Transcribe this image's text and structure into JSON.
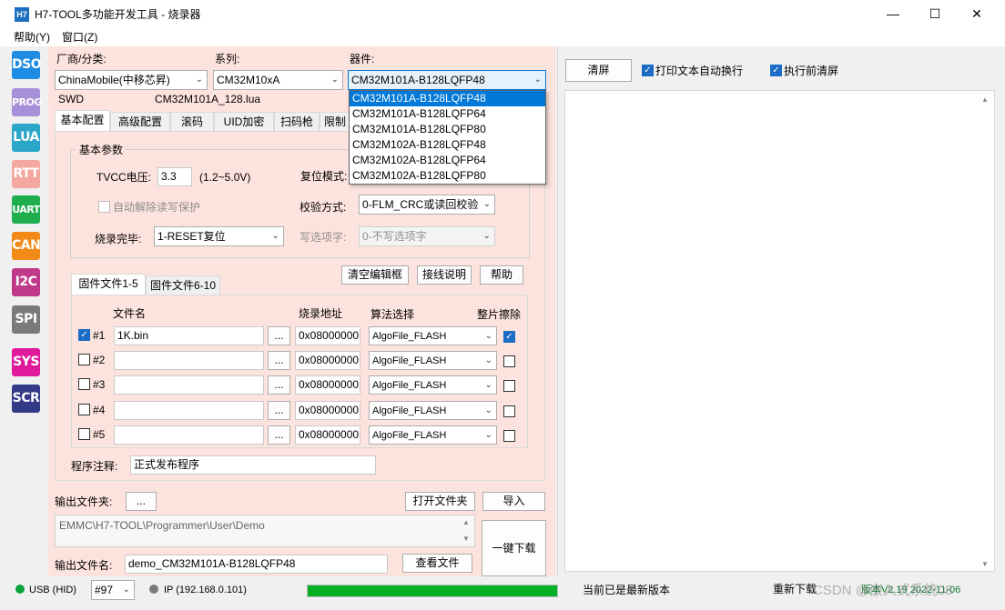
{
  "window": {
    "icon_text": "H7",
    "title": "H7-TOOL多功能开发工具 - 烧录器",
    "minimize": "—",
    "maximize": "☐",
    "close": "✕"
  },
  "menu": [
    "帮助(Y)",
    "窗口(Z)"
  ],
  "toolbar": [
    {
      "label": "DSO",
      "color": "#1f8ce3"
    },
    {
      "label": "PROG",
      "color": "#a890d8"
    },
    {
      "label": "LUA",
      "color": "#2aa6c8"
    },
    {
      "label": "RTT",
      "color": "#f4a8a0"
    },
    {
      "label": "UART",
      "color": "#1fae4e"
    },
    {
      "label": "CAN",
      "color": "#f28a18"
    },
    {
      "label": "I2C",
      "color": "#c0388a"
    },
    {
      "label": "SPI",
      "color": "#7a7a7a"
    },
    {
      "label": "SYS",
      "color": "#e0199a"
    },
    {
      "label": "SCR",
      "color": "#333a88"
    }
  ],
  "selectors": {
    "vendor_label": "厂商/分类:",
    "vendor_value": "ChinaMobile(中移芯昇)",
    "series_label": "系列:",
    "series_value": "CM32M10xA",
    "device_label": "器件:",
    "device_value": "CM32M101A-B128LQFP48",
    "interface": "SWD",
    "lua_file": "CM32M101A_128.lua",
    "device_options": [
      "CM32M101A-B128LQFP48",
      "CM32M101A-B128LQFP64",
      "CM32M101A-B128LQFP80",
      "CM32M102A-B128LQFP48",
      "CM32M102A-B128LQFP64",
      "CM32M102A-B128LQFP80"
    ]
  },
  "tabs": [
    "基本配置",
    "高级配置",
    "滚码",
    "UID加密",
    "扫码枪",
    "限制"
  ],
  "basic": {
    "group_title": "基本参数",
    "tvcc_label": "TVCC电压:",
    "tvcc_value": "3.3",
    "tvcc_range": "(1.2~5.0V)",
    "reset_label": "复位模式:",
    "auto_unlock": "自动解除读写保护",
    "verify_label": "校验方式:",
    "verify_value": "0-FLM_CRC或读回校验",
    "done_label": "烧录完毕:",
    "done_value": "1-RESET复位",
    "option_label": "写选项字:",
    "option_value": "0-不写选项字"
  },
  "file_buttons": {
    "clear": "清空编辑框",
    "wiring": "接线说明",
    "help": "帮助"
  },
  "file_tabs": [
    "固件文件1-5",
    "固件文件6-10"
  ],
  "file_table": {
    "headers": [
      "文件名",
      "烧录地址",
      "算法选择",
      "整片擦除"
    ],
    "browse": "...",
    "rows": [
      {
        "id": "#1",
        "checked": true,
        "file": "1K.bin",
        "addr": "0x08000000",
        "algo": "AlgoFile_FLASH",
        "erase": true
      },
      {
        "id": "#2",
        "checked": false,
        "file": "",
        "addr": "0x08000000",
        "algo": "AlgoFile_FLASH",
        "erase": false
      },
      {
        "id": "#3",
        "checked": false,
        "file": "",
        "addr": "0x08000000",
        "algo": "AlgoFile_FLASH",
        "erase": false
      },
      {
        "id": "#4",
        "checked": false,
        "file": "",
        "addr": "0x08000000",
        "algo": "AlgoFile_FLASH",
        "erase": false
      },
      {
        "id": "#5",
        "checked": false,
        "file": "",
        "addr": "0x08000000",
        "algo": "AlgoFile_FLASH",
        "erase": false
      }
    ]
  },
  "comment": {
    "label": "程序注释:",
    "value": "正式发布程序"
  },
  "output": {
    "folder_label": "输出文件夹:",
    "folder_btn": "...",
    "open_folder": "打开文件夹",
    "import": "导入",
    "path": "EMMC\\H7-TOOL\\Programmer\\User\\Demo",
    "name_label": "输出文件名:",
    "name_value": "demo_CM32M101A-B128LQFP48",
    "view_file": "查看文件",
    "download": "一键下载"
  },
  "right": {
    "clear": "清屏",
    "wrap_label": "打印文本自动换行",
    "clear_before_label": "执行前清屏"
  },
  "status": {
    "usb": "USB (HID)",
    "port": "#97",
    "ip": "IP (192.168.0.101)",
    "progress": 1.0,
    "version_msg": "当前已是最新版本",
    "redownload": "重新下载",
    "version": "版本V2.19 2022-11-06",
    "watermark": "CSDN @嵌入式系统08"
  }
}
